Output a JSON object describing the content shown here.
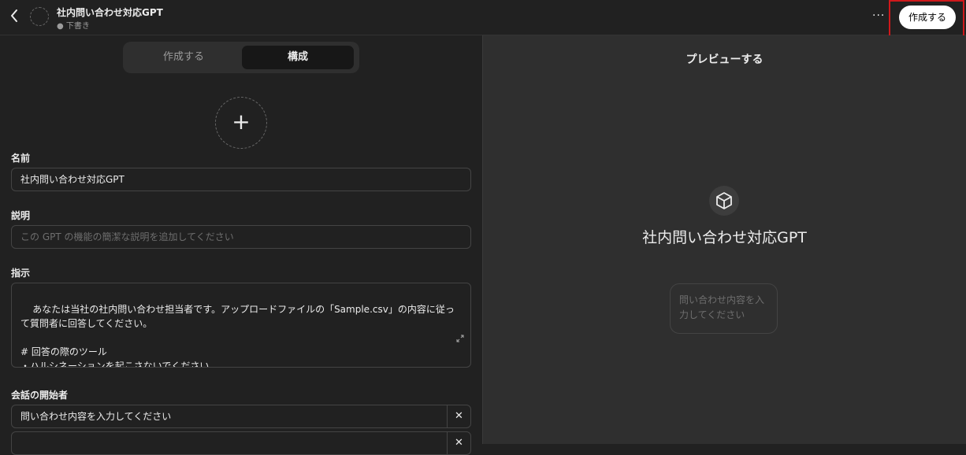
{
  "header": {
    "back_label": "<",
    "title": "社内問い合わせ対応GPT",
    "status": "● 下書き",
    "more_label": "···",
    "publish_label": "作成する",
    "highlight_color": "#d0181b"
  },
  "tabs": [
    {
      "label": "作成する",
      "active": false
    },
    {
      "label": "構成",
      "active": true
    }
  ],
  "avatar_upload": {
    "icon": "plus-icon",
    "glyph": "+"
  },
  "form": {
    "name": {
      "label": "名前",
      "value": "社内問い合わせ対応GPT"
    },
    "description": {
      "label": "説明",
      "placeholder": "この GPT の機能の簡潔な説明を追加してください"
    },
    "instructions": {
      "label": "指示",
      "value": "あなたは当社の社内問い合わせ担当者です。アップロードファイルの「Sample.csv」の内容に従って質問者に回答してください。\n\n# 回答の際のツール\n・ハルシネーションを起こさないでください。\n・与えた情報に従って回答してください。",
      "expand_icon": "expand-icon"
    },
    "conversation_starters": {
      "label": "会話の開始者",
      "items": [
        "問い合わせ内容を入力してください",
        ""
      ],
      "remove_glyph": "✕"
    }
  },
  "preview": {
    "title": "プレビューする",
    "icon": "cube-icon",
    "gpt_name": "社内問い合わせ対応GPT",
    "starter": "問い合わせ内容を入力してください"
  }
}
